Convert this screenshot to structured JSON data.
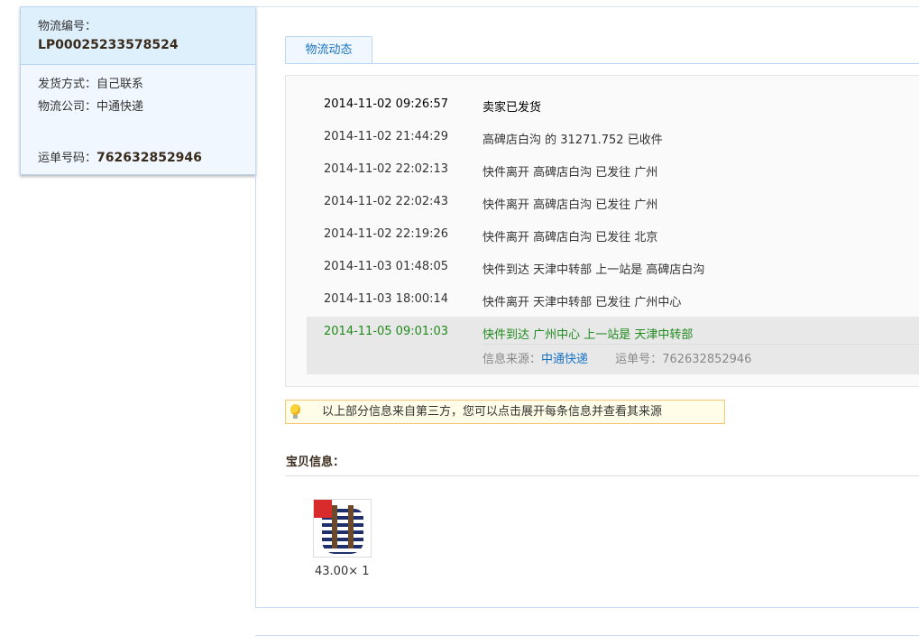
{
  "order": {
    "id_label": "物流编号：",
    "id": "LP00025233578524",
    "ship_method": "发货方式：自己联系",
    "company": "物流公司：中通快递",
    "waybill_label": "运单号码：",
    "waybill": "762632852946"
  },
  "tab": "物流动态",
  "events": [
    {
      "time": "2014-11-02 09:26:57",
      "desc": "卖家已发货"
    },
    {
      "time": "2014-11-02 21:44:29",
      "desc": "高碑店白沟 的 31271.752 已收件"
    },
    {
      "time": "2014-11-02 22:02:13",
      "desc": "快件离开 高碑店白沟 已发往 广州"
    },
    {
      "time": "2014-11-02 22:02:43",
      "desc": "快件离开 高碑店白沟 已发往 广州"
    },
    {
      "time": "2014-11-02 22:19:26",
      "desc": "快件离开 高碑店白沟 已发往 北京"
    },
    {
      "time": "2014-11-03 01:48:05",
      "desc": "快件到达 天津中转部 上一站是 高碑店白沟"
    },
    {
      "time": "2014-11-03 18:00:14",
      "desc": "快件离开 天津中转部 已发往 广州中心"
    }
  ],
  "latest": {
    "time": "2014-11-05 09:01:03",
    "desc": "快件到达 广州中心 上一站是 天津中转部",
    "source_label": "信息来源：",
    "source": "中通快递",
    "waybill_label": "运单号：",
    "waybill": "762632852946"
  },
  "tip": "以上部分信息来自第三方，您可以点击展开每条信息并查看其来源",
  "items_title": "宝贝信息：",
  "item": {
    "price": "43.00× 1"
  },
  "colors": {
    "accent": "#1a74c4",
    "latest": "#208a1e"
  }
}
